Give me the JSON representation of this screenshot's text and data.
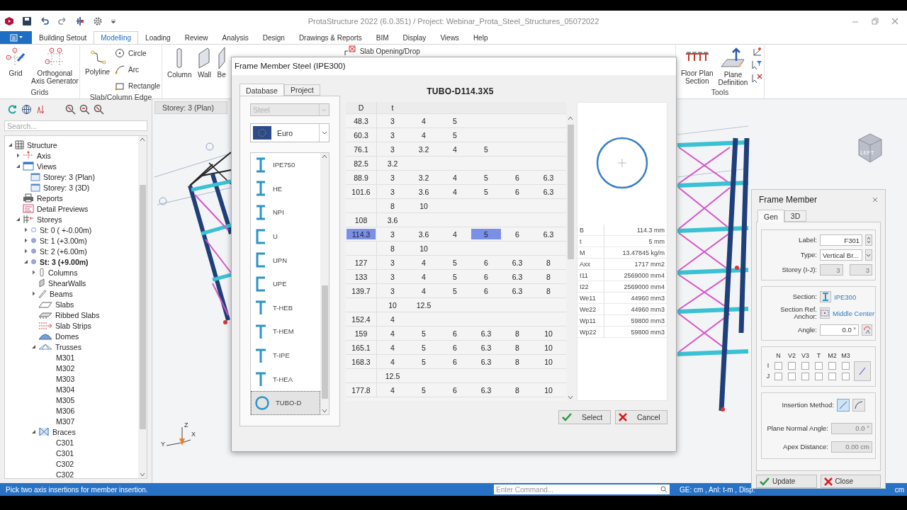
{
  "window": {
    "title": "ProtaStructure 2022 (6.0.351) / Project: Webinar_Prota_Steel_Structures_05072022"
  },
  "menu_tabs": [
    {
      "label": "Building Setout",
      "selected": false
    },
    {
      "label": "Modelling",
      "selected": true
    },
    {
      "label": "Loading",
      "selected": false
    },
    {
      "label": "Review",
      "selected": false
    },
    {
      "label": "Analysis",
      "selected": false
    },
    {
      "label": "Design",
      "selected": false
    },
    {
      "label": "Drawings & Reports",
      "selected": false
    },
    {
      "label": "BIM",
      "selected": false
    },
    {
      "label": "Display",
      "selected": false
    },
    {
      "label": "Views",
      "selected": false
    },
    {
      "label": "Help",
      "selected": false
    }
  ],
  "ribbon": {
    "grids": {
      "label": "Grids",
      "buttons": [
        {
          "label": "Grid",
          "kind": "grid"
        },
        {
          "label": "Orthogonal\nAxis Generator",
          "kind": "axis"
        }
      ]
    },
    "edges": {
      "label": "Slab/Column Edge",
      "large": [
        {
          "label": "Polyline",
          "kind": "polyline"
        }
      ],
      "small": [
        {
          "label": "Circle",
          "kind": "circle"
        },
        {
          "label": "Arc",
          "kind": "arc"
        },
        {
          "label": "Rectangle",
          "kind": "rectangle"
        }
      ]
    },
    "members": {
      "large": [
        {
          "label": "Column",
          "kind": "column"
        },
        {
          "label": "Wall",
          "kind": "wall"
        },
        {
          "label": "Be",
          "kind": "beam"
        }
      ],
      "small": [
        {
          "label": "Slab Opening/Drop",
          "kind": "opening"
        }
      ]
    },
    "tools": {
      "label": "Tools",
      "buttons": [
        {
          "label": "Floor Plan\nSection",
          "kind": "floorplan"
        },
        {
          "label": "Plane\nDefinition",
          "kind": "plane"
        }
      ]
    }
  },
  "explorer": {
    "search": {
      "placeholder": "Search..."
    },
    "tree": [
      {
        "label": "Structure",
        "kind": "structure",
        "expanded": true,
        "children": [
          {
            "label": "Axis",
            "kind": "axis",
            "expanded": false
          },
          {
            "label": "Views",
            "kind": "views",
            "expanded": true,
            "children": [
              {
                "label": "Storey: 3 (Plan)",
                "kind": "plan"
              },
              {
                "label": "Storey: 3 (3D)",
                "kind": "view3d"
              }
            ]
          },
          {
            "label": "Reports",
            "kind": "reports"
          },
          {
            "label": "Detail Previews",
            "kind": "previews"
          },
          {
            "label": "Storeys",
            "kind": "storeys",
            "expanded": true,
            "children": [
              {
                "label": "St: 0 ( +-0.00m)",
                "kind": "storey",
                "expanded": false,
                "filled": false,
                "current": false
              },
              {
                "label": "St: 1 (+3.00m)",
                "kind": "storey",
                "expanded": false,
                "filled": true,
                "current": false
              },
              {
                "label": "St: 2 (+6.00m)",
                "kind": "storey",
                "expanded": false,
                "filled": true,
                "current": false
              },
              {
                "label": "St: 3 (+9.00m)",
                "kind": "storey",
                "expanded": true,
                "filled": true,
                "current": true,
                "children": [
                  {
                    "label": "Columns",
                    "kind": "columns",
                    "expanded": false
                  },
                  {
                    "label": "ShearWalls",
                    "kind": "walls"
                  },
                  {
                    "label": "Beams",
                    "kind": "beams",
                    "expanded": false
                  },
                  {
                    "label": "Slabs",
                    "kind": "slabs"
                  },
                  {
                    "label": "Ribbed Slabs",
                    "kind": "ribbed"
                  },
                  {
                    "label": "Slab Strips",
                    "kind": "strips"
                  },
                  {
                    "label": "Domes",
                    "kind": "domes"
                  },
                  {
                    "label": "Trusses",
                    "kind": "trusses",
                    "expanded": true,
                    "children": [
                      {
                        "label": "M301",
                        "kind": "member"
                      },
                      {
                        "label": "M302",
                        "kind": "member"
                      },
                      {
                        "label": "M303",
                        "kind": "member"
                      },
                      {
                        "label": "M304",
                        "kind": "member"
                      },
                      {
                        "label": "M305",
                        "kind": "member"
                      },
                      {
                        "label": "M306",
                        "kind": "member"
                      },
                      {
                        "label": "M307",
                        "kind": "member"
                      }
                    ]
                  },
                  {
                    "label": "Braces",
                    "kind": "braces",
                    "expanded": true,
                    "children": [
                      {
                        "label": "C301",
                        "kind": "member"
                      },
                      {
                        "label": "C301",
                        "kind": "member"
                      },
                      {
                        "label": "C302",
                        "kind": "member"
                      },
                      {
                        "label": "C302",
                        "kind": "member"
                      }
                    ]
                  }
                ]
              }
            ]
          }
        ]
      }
    ]
  },
  "viewport": {
    "tab": "Storey: 3 (Plan)",
    "axes": {
      "x": "X",
      "y": "Y",
      "z": "Z"
    },
    "view_cube": "LEFT"
  },
  "section_dialog": {
    "title": "Frame Member Steel (IPE300)",
    "tabs": [
      {
        "label": "Database",
        "selected": true
      },
      {
        "label": "Project",
        "selected": false
      }
    ],
    "material": {
      "value": "Steel",
      "disabled": true
    },
    "standard": {
      "value": "Euro"
    },
    "sections": [
      {
        "label": "IPE750",
        "kind": "i",
        "selected": false
      },
      {
        "label": "HE",
        "kind": "i",
        "selected": false
      },
      {
        "label": "NPI",
        "kind": "i",
        "selected": false
      },
      {
        "label": "U",
        "kind": "c",
        "selected": false
      },
      {
        "label": "UPN",
        "kind": "c",
        "selected": false
      },
      {
        "label": "UPE",
        "kind": "c",
        "selected": false
      },
      {
        "label": "T-HEB",
        "kind": "t",
        "selected": false
      },
      {
        "label": "T-HEM",
        "kind": "t",
        "selected": false
      },
      {
        "label": "T-IPE",
        "kind": "t",
        "selected": false
      },
      {
        "label": "T-HEA",
        "kind": "t",
        "selected": false
      },
      {
        "label": "TUBO-D",
        "kind": "o",
        "selected": true
      }
    ],
    "profile_title": "TUBO-D114.3X5",
    "table": {
      "columns": [
        "D",
        "t"
      ],
      "rows": [
        {
          "d": "48.3",
          "selected": false,
          "t": [
            {
              "value": "3",
              "selected": false
            },
            {
              "value": "4",
              "selected": false
            },
            {
              "value": "5",
              "selected": false
            }
          ]
        },
        {
          "d": "60.3",
          "selected": false,
          "t": [
            {
              "value": "3",
              "selected": false
            },
            {
              "value": "4",
              "selected": false
            },
            {
              "value": "5",
              "selected": false
            }
          ]
        },
        {
          "d": "76.1",
          "selected": false,
          "t": [
            {
              "value": "3",
              "selected": false
            },
            {
              "value": "3.2",
              "selected": false
            },
            {
              "value": "4",
              "selected": false
            },
            {
              "value": "5",
              "selected": false
            }
          ]
        },
        {
          "d": "82.5",
          "selected": false,
          "t": [
            {
              "value": "3.2",
              "selected": false
            }
          ]
        },
        {
          "d": "88.9",
          "selected": false,
          "t": [
            {
              "value": "3",
              "selected": false
            },
            {
              "value": "3.2",
              "selected": false
            },
            {
              "value": "4",
              "selected": false
            },
            {
              "value": "5",
              "selected": false
            },
            {
              "value": "6",
              "selected": false
            },
            {
              "value": "6.3",
              "selected": false
            }
          ]
        },
        {
          "d": "101.6",
          "selected": false,
          "t": [
            {
              "value": "3",
              "selected": false
            },
            {
              "value": "3.6",
              "selected": false
            },
            {
              "value": "4",
              "selected": false
            },
            {
              "value": "5",
              "selected": false
            },
            {
              "value": "6",
              "selected": false
            },
            {
              "value": "6.3",
              "selected": false
            }
          ]
        },
        {
          "selected": false,
          "t": [
            {
              "value": "8",
              "selected": false
            },
            {
              "value": "10",
              "selected": false
            }
          ]
        },
        {
          "d": "108",
          "selected": false,
          "t": [
            {
              "value": "3.6",
              "selected": false
            }
          ]
        },
        {
          "d": "114.3",
          "selected": true,
          "t": [
            {
              "value": "3",
              "selected": false
            },
            {
              "value": "3.6",
              "selected": false
            },
            {
              "value": "4",
              "selected": false
            },
            {
              "value": "5",
              "selected": true
            },
            {
              "value": "6",
              "selected": false
            },
            {
              "value": "6.3",
              "selected": false
            }
          ]
        },
        {
          "selected": false,
          "t": [
            {
              "value": "8",
              "selected": false
            },
            {
              "value": "10",
              "selected": false
            }
          ]
        },
        {
          "d": "127",
          "selected": false,
          "t": [
            {
              "value": "3",
              "selected": false
            },
            {
              "value": "4",
              "selected": false
            },
            {
              "value": "5",
              "selected": false
            },
            {
              "value": "6",
              "selected": false
            },
            {
              "value": "6.3",
              "selected": false
            },
            {
              "value": "8",
              "selected": false
            }
          ]
        },
        {
          "d": "133",
          "selected": false,
          "t": [
            {
              "value": "3",
              "selected": false
            },
            {
              "value": "4",
              "selected": false
            },
            {
              "value": "5",
              "selected": false
            },
            {
              "value": "6",
              "selected": false
            },
            {
              "value": "6.3",
              "selected": false
            },
            {
              "value": "8",
              "selected": false
            }
          ]
        },
        {
          "d": "139.7",
          "selected": false,
          "t": [
            {
              "value": "3",
              "selected": false
            },
            {
              "value": "4",
              "selected": false
            },
            {
              "value": "5",
              "selected": false
            },
            {
              "value": "6",
              "selected": false
            },
            {
              "value": "6.3",
              "selected": false
            },
            {
              "value": "8",
              "selected": false
            }
          ]
        },
        {
          "selected": false,
          "t": [
            {
              "value": "10",
              "selected": false
            },
            {
              "value": "12.5",
              "selected": false
            }
          ]
        },
        {
          "d": "152.4",
          "selected": false,
          "t": [
            {
              "value": "4",
              "selected": false
            }
          ]
        },
        {
          "d": "159",
          "selected": false,
          "t": [
            {
              "value": "4",
              "selected": false
            },
            {
              "value": "5",
              "selected": false
            },
            {
              "value": "6",
              "selected": false
            },
            {
              "value": "6.3",
              "selected": false
            },
            {
              "value": "8",
              "selected": false
            },
            {
              "value": "10",
              "selected": false
            }
          ]
        },
        {
          "d": "165.1",
          "selected": false,
          "t": [
            {
              "value": "4",
              "selected": false
            },
            {
              "value": "5",
              "selected": false
            },
            {
              "value": "6",
              "selected": false
            },
            {
              "value": "6.3",
              "selected": false
            },
            {
              "value": "8",
              "selected": false
            },
            {
              "value": "10",
              "selected": false
            }
          ]
        },
        {
          "d": "168.3",
          "selected": false,
          "t": [
            {
              "value": "4",
              "selected": false
            },
            {
              "value": "5",
              "selected": false
            },
            {
              "value": "6",
              "selected": false
            },
            {
              "value": "6.3",
              "selected": false
            },
            {
              "value": "8",
              "selected": false
            },
            {
              "value": "10",
              "selected": false
            }
          ]
        },
        {
          "selected": false,
          "t": [
            {
              "value": "12.5",
              "selected": false
            }
          ]
        },
        {
          "d": "177.8",
          "selected": false,
          "t": [
            {
              "value": "4",
              "selected": false
            },
            {
              "value": "5",
              "selected": false
            },
            {
              "value": "6",
              "selected": false
            },
            {
              "value": "6.3",
              "selected": false
            },
            {
              "value": "8",
              "selected": false
            },
            {
              "value": "10",
              "selected": false
            }
          ]
        }
      ]
    },
    "properties": [
      {
        "name": "B",
        "value": "114.3 mm"
      },
      {
        "name": "t",
        "value": "5 mm"
      },
      {
        "name": "M",
        "value": "13.47845 kg/m"
      },
      {
        "name": "Axx",
        "value": "1717 mm2"
      },
      {
        "name": "I11",
        "value": "2569000 mm4"
      },
      {
        "name": "I22",
        "value": "2569000 mm4"
      },
      {
        "name": "We11",
        "value": "44960 mm3"
      },
      {
        "name": "We22",
        "value": "44960 mm3"
      },
      {
        "name": "Wp11",
        "value": "59800 mm3"
      },
      {
        "name": "Wp22",
        "value": "59800 mm3"
      }
    ],
    "buttons": [
      {
        "label": "Select",
        "kind": "ok"
      },
      {
        "label": "Cancel",
        "kind": "cancel"
      }
    ]
  },
  "frame_member": {
    "title": "Frame Member",
    "tabs": [
      {
        "label": "Gen",
        "selected": true
      },
      {
        "label": "3D",
        "selected": false
      }
    ],
    "label": {
      "label": "Label:",
      "value": "F301"
    },
    "type": {
      "label": "Type:",
      "value": "Vertical Br..."
    },
    "storey": {
      "label": "Storey (I-J):",
      "values": [
        "3",
        "3"
      ],
      "disabled": true
    },
    "section": {
      "label": "Section:",
      "value": "IPE300"
    },
    "anchor": {
      "label": "Section Ref.\nAnchor:",
      "value": "Middle Center"
    },
    "angle": {
      "label": "Angle:",
      "value": "0.0 °"
    },
    "releases": {
      "columns": [
        "N",
        "V2",
        "V3",
        "T",
        "M2",
        "M3"
      ],
      "rows": [
        {
          "label": "I",
          "checked": [
            false,
            false,
            false,
            false,
            false,
            false
          ]
        },
        {
          "label": "J",
          "checked": [
            false,
            false,
            false,
            false,
            false,
            false
          ]
        }
      ]
    },
    "insertion": {
      "label": "Insertion Method:",
      "options": [
        {
          "kind": "line",
          "selected": true
        },
        {
          "kind": "arc",
          "selected": false
        }
      ]
    },
    "plane_angle": {
      "label": "Plane Normal Angle:",
      "value": "0.0 °",
      "disabled": true
    },
    "apex": {
      "label": "Apex Distance:",
      "value": "0.00 cm",
      "disabled": true
    },
    "buttons": [
      {
        "label": "Update",
        "kind": "ok"
      },
      {
        "label": "Close",
        "kind": "cancel"
      }
    ]
  },
  "status_bar": {
    "message": "Pick two axis insertions for member insertion.",
    "command": {
      "placeholder": "Enter Command..."
    },
    "units": "GE: cm , Anl: t-m , Disp:",
    "tail": "cm"
  }
}
